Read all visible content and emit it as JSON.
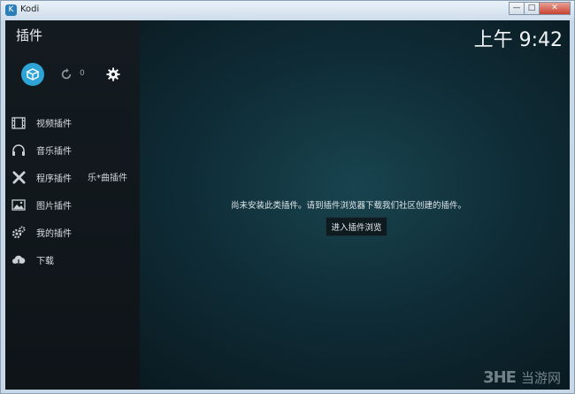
{
  "window": {
    "title": "Kodi",
    "app_icon_glyph": "K",
    "controls": {
      "minimize": "—",
      "maximize": "□",
      "close": "✕"
    }
  },
  "header": {
    "title": "插件",
    "clock": "上午 9:42"
  },
  "toolbar": {
    "addon_icon": "box-open-icon",
    "update_icon": "refresh-icon",
    "update_count": "0",
    "settings_icon": "gear-icon"
  },
  "sidebar": {
    "items": [
      {
        "label": "视频插件",
        "icon": "film-icon"
      },
      {
        "label": "音乐插件",
        "icon": "headphones-icon"
      },
      {
        "label": "程序插件",
        "icon": "tools-icon",
        "overlay": "乐*曲插件"
      },
      {
        "label": "图片插件",
        "icon": "image-icon"
      },
      {
        "label": "我的插件",
        "icon": "gears-icon"
      },
      {
        "label": "下载",
        "icon": "cloud-download-icon"
      }
    ]
  },
  "main": {
    "message": "尚未安装此类插件。请到插件浏览器下载我们社区创建的插件。",
    "browse_button": "进入插件浏览"
  },
  "watermark": {
    "logo": "3HE",
    "text": "当游网"
  },
  "colors": {
    "accent": "#2ea3d6",
    "sidebar_bg": "#141b20",
    "main_bg": "#0f2c36"
  }
}
